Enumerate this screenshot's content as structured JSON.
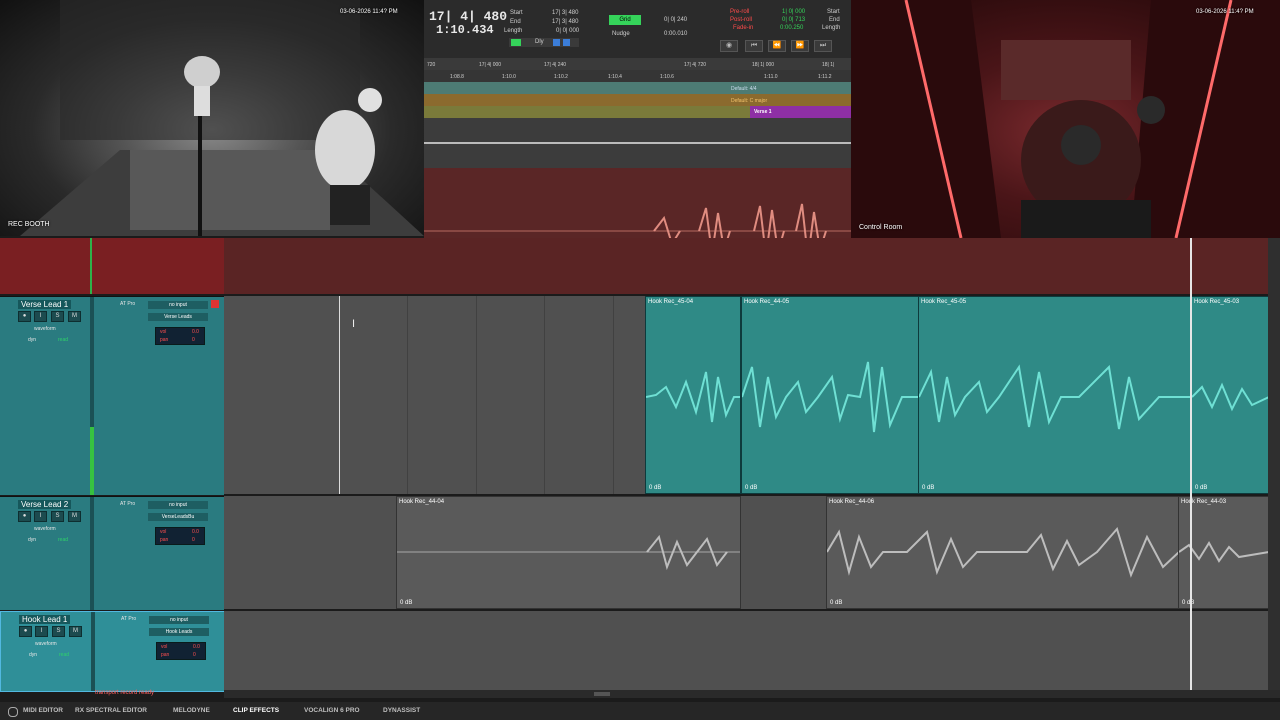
{
  "cameras": {
    "booth": {
      "label": "REC BOOTH",
      "timestamp": "03-06-2026 11:4? PM"
    },
    "control": {
      "label": "Control Room",
      "timestamp": "03-06-2026 11:4? PM"
    }
  },
  "counter": {
    "bars_beats": "17| 4| 480",
    "min_sec": "1:10.434",
    "start_label": "Start",
    "start_value": "17| 3| 480",
    "end_label": "End",
    "end_value": "17| 3| 480",
    "length_label": "Length",
    "length_value": "0| 0| 000",
    "grid_label": "Grid",
    "grid_value": "0| 0| 240",
    "nudge_label": "Nudge",
    "nudge_value": "0:00.010",
    "preroll_label": "Pre-roll",
    "preroll_value": "1| 0| 000",
    "postroll_label": "Post-roll",
    "postroll_value": "0| 0| 713",
    "fadein_label": "Fade-in",
    "fadein_value": "0:00.250",
    "start2_label": "Start",
    "end2_label": "End",
    "length2_label": "Length",
    "dly_label": "Dly"
  },
  "rulers": {
    "bars_ticks": [
      "720",
      "17| 4| 000",
      "17| 4| 240",
      "17| 4| 720",
      "18| 1| 000",
      "18| 1|"
    ],
    "min_ticks": [
      "1:08.8",
      "1:10.0",
      "1:10.2",
      "1:10.4",
      "1:10.6",
      "1:11.0",
      "1:11.2"
    ],
    "meter": "Default: 4/4",
    "key": "Default: C major",
    "marker": "Verse 1"
  },
  "tracks": [
    {
      "name": "Verse Lead 1",
      "insert": "AT Pro",
      "input": "no input",
      "output": "Verse Leads",
      "view": "waveform",
      "dyn": "dyn",
      "read": "read",
      "vol": "vol",
      "vol_value": "0.0",
      "pan": "pan",
      "pan_value": "0",
      "clips": [
        {
          "name": "Hook Rec_45-04",
          "gain": "0 dB"
        },
        {
          "name": "Hook Rec_44-05",
          "gain": "0 dB"
        },
        {
          "name": "Hook Rec_45-05",
          "gain": "0 dB"
        },
        {
          "name": "Hook Rec_45-03",
          "gain": "0 dB"
        }
      ]
    },
    {
      "name": "Verse Lead 2",
      "insert": "AT Pro",
      "input": "no input",
      "output": "VerseLeadsBu",
      "view": "waveform",
      "dyn": "dyn",
      "read": "read",
      "vol": "vol",
      "vol_value": "0.0",
      "pan": "pan",
      "pan_value": "0",
      "clips": [
        {
          "name": "Hook Rec_44-04",
          "gain": "0 dB"
        },
        {
          "name": "Hook Rec_44-06",
          "gain": "0 dB"
        },
        {
          "name": "Hook Rec_44-03",
          "gain": "0 dB"
        }
      ]
    },
    {
      "name": "Hook Lead 1",
      "insert": "AT Pro",
      "input": "no input",
      "output": "Hook Leads",
      "view": "waveform",
      "dyn": "dyn",
      "read": "read",
      "vol": "vol",
      "vol_value": "0.0",
      "pan": "pan",
      "pan_value": "0"
    }
  ],
  "status": "transport record ready",
  "bottom_tabs": [
    "MIDI EDITOR",
    "RX SPECTRAL EDITOR",
    "MELODYNE",
    "CLIP EFFECTS",
    "VOCALIGN 6 PRO",
    "DYNASSIST"
  ],
  "colors": {
    "track": "#2a7b80",
    "clip_active": "#2f8a86",
    "clip_inactive": "#5a5a5a",
    "waveform_active": "#6fe0d4",
    "record_red": "#7a1f22"
  }
}
